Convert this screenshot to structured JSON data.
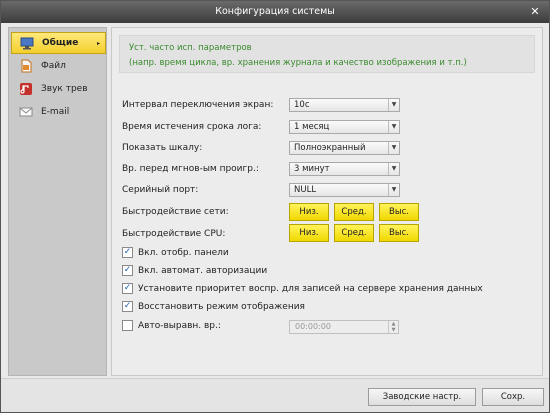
{
  "window": {
    "title": "Конфигурация системы",
    "close_glyph": "✕"
  },
  "sidebar": {
    "items": [
      {
        "label": "Общие",
        "icon": "monitor-icon",
        "active": true,
        "arrow": "▸"
      },
      {
        "label": "Файл",
        "icon": "file-icon"
      },
      {
        "label": "Звук трев",
        "icon": "sound-alarm-icon"
      },
      {
        "label": "E-mail",
        "icon": "envelope-icon"
      }
    ]
  },
  "info": {
    "line1": "Уст. часто исп. параметров",
    "line2": "(напр. время цикла, вр. хранения журнала и качество изображения и т.п.)"
  },
  "settings": {
    "interval_label": "Интервал переключения экран:",
    "interval_value": "10с",
    "log_expire_label": "Время истечения срока лога:",
    "log_expire_value": "1 месяц",
    "scale_label": "Показать шкалу:",
    "scale_value": "Полноэкранный",
    "instant_label": "Вр. перед мгнов-ым проигр.:",
    "instant_value": "3 минут",
    "serial_label": "Серийный порт:",
    "serial_value": "NULL",
    "net_label": "Быстродействие сети:",
    "cpu_label": "Быстродействие CPU:",
    "btn_low": "Низ.",
    "btn_mid": "Сред.",
    "btn_high": "Выс.",
    "dropdown_glyph": "▼"
  },
  "checks": {
    "panel": "Вкл. отобр. панели",
    "autologin": "Вкл. автомат. авторизации",
    "priority": "Установите приоритет воспр. для записей на сервере хранения данных",
    "restore": "Восстановить режим отображения",
    "autoalign": "Авто-выравн. вр.:",
    "checkmark": "✓"
  },
  "time_value": "00:00:00",
  "footer": {
    "defaults": "Заводские настр.",
    "save": "Сохр."
  }
}
